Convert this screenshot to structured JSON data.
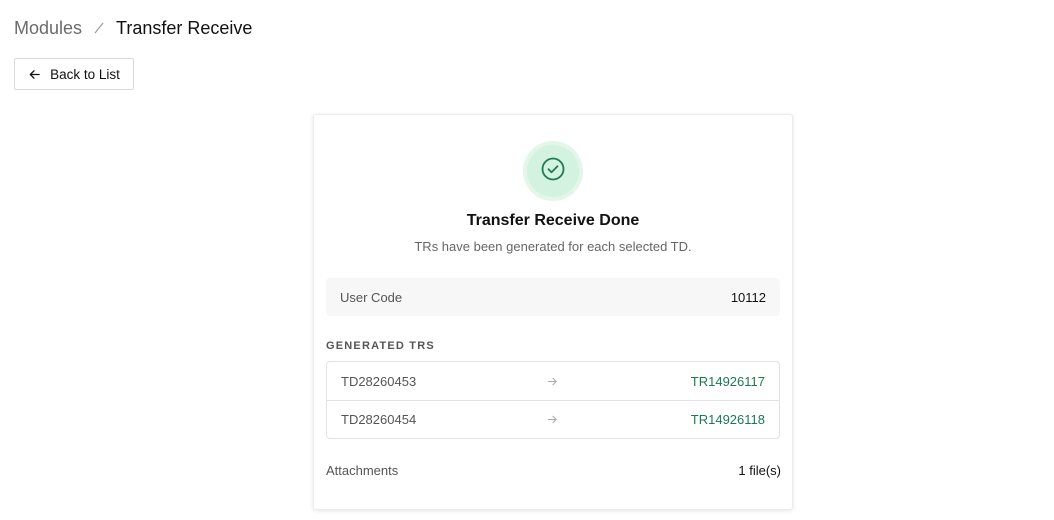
{
  "breadcrumb": {
    "parent": "Modules",
    "current": "Transfer Receive"
  },
  "back_button": {
    "label": "Back to List",
    "icon": "arrow-left-icon"
  },
  "result": {
    "icon": "check-circle-icon",
    "title": "Transfer Receive Done",
    "subtitle": "TRs have been generated for each selected TD."
  },
  "user_code": {
    "label": "User Code",
    "value": "10112"
  },
  "generated": {
    "section_label": "GENERATED TRS",
    "rows": [
      {
        "td": "TD28260453",
        "tr": "TR14926117"
      },
      {
        "td": "TD28260454",
        "tr": "TR14926118"
      }
    ]
  },
  "attachments": {
    "label": "Attachments",
    "value": "1 file(s)"
  },
  "colors": {
    "accent_green": "#1a7a52",
    "success_bg": "#e2f6ea",
    "success_icon": "#1f7a55"
  }
}
